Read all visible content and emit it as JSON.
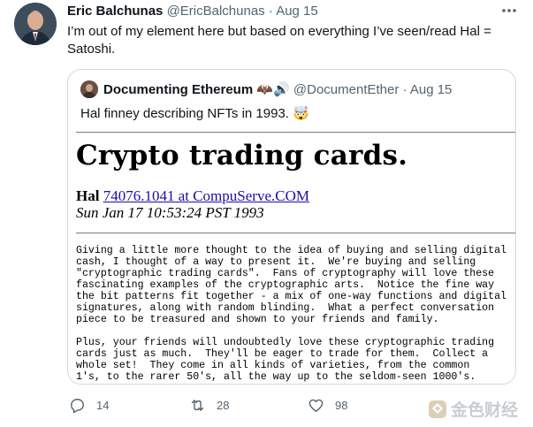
{
  "tweet": {
    "author_name": "Eric Balchunas",
    "author_handle": "@EricBalchunas",
    "separator": "·",
    "date": "Aug 15",
    "text": "I’m out of my element here but based on everything I’ve seen/read Hal = Satoshi."
  },
  "quoted": {
    "author_name": "Documenting Ethereum",
    "author_name_emoji": "🦇🔊",
    "author_handle": "@DocumentEther",
    "separator": "·",
    "date": "Aug 15",
    "text": "Hal finney describing NFTs in 1993. 🤯",
    "document": {
      "title": "Crypto trading cards.",
      "author": "Hal",
      "email": "74076.1041 at CompuServe.COM",
      "date": "Sun Jan 17 10:53:24 PST 1993",
      "body": "Giving a little more thought to the idea of buying and selling digital\ncash, I thought of a way to present it.  We're buying and selling\n\"cryptographic trading cards\".  Fans of cryptography will love these\nfascinating examples of the cryptographic arts.  Notice the fine way\nthe bit patterns fit together - a mix of one-way functions and digital\nsignatures, along with random blinding.  What a perfect conversation\npiece to be treasured and shown to your friends and family.\n\nPlus, your friends will undoubtedly love these cryptographic trading\ncards just as much.  They'll be eager to trade for them.  Collect a\nwhole set!  They come in all kinds of varieties, from the common\n1's, to the rarer 50's, all the way up to the seldom-seen 1000's."
    }
  },
  "actions": {
    "replies": "14",
    "retweets": "28",
    "likes": "98"
  },
  "icons": {
    "more": "more-horizontal-icon",
    "reply": "reply-icon",
    "retweet": "retweet-icon",
    "like": "heart-icon",
    "share": "share-icon"
  },
  "watermark": {
    "text": "金色财经"
  },
  "colors": {
    "muted": "#536471",
    "text": "#0f1419",
    "border": "#cfd9de",
    "link": "#1a0dab"
  }
}
